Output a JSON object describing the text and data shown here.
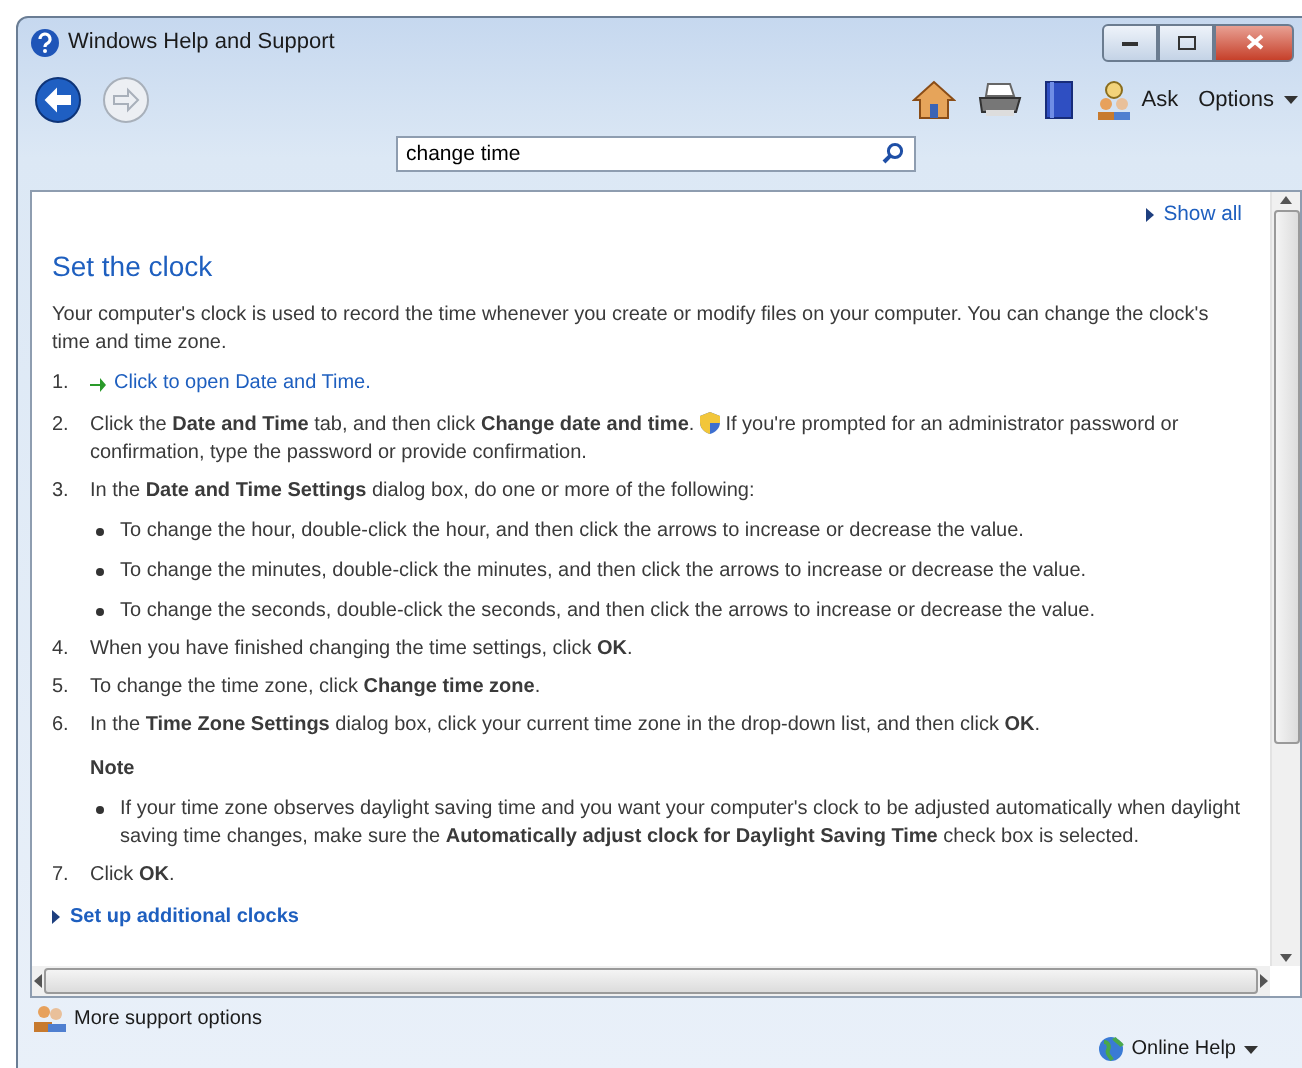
{
  "window": {
    "title": "Windows Help and Support"
  },
  "toolbar": {
    "back": {
      "disabled": false
    },
    "forward": {
      "disabled": true
    },
    "ask": "Ask",
    "options": "Options"
  },
  "search": {
    "value": "change time"
  },
  "content": {
    "show_all": "Show all",
    "heading": "Set the clock",
    "intro": "Your computer's clock is used to record the time whenever you create or modify files on your computer. You can change the clock's time and time zone.",
    "steps": [
      {
        "number": "1.",
        "kind": "link",
        "text": "Click to open Date and Time."
      },
      {
        "number": "2.",
        "kind": "text",
        "text": "Click the **Date and Time** tab, and then click **Change date and time**.",
        "text_after": "If you're prompted for an administrator password or confirmation, type the password or provide confirmation."
      },
      {
        "number": "3.",
        "kind": "text",
        "text": "In the **Date and Time Settings** dialog box, do one or more of the following:",
        "bullets": [
          "To change the hour, double-click the hour, and then click the arrows to increase or decrease the value.",
          "To change the minutes, double-click the minutes, and then click the arrows to increase or decrease the value.",
          "To change the seconds, double-click the seconds, and then click the arrows to increase or decrease the value."
        ]
      },
      {
        "number": "4.",
        "kind": "text",
        "text": "When you have finished changing the time settings, click **OK**."
      },
      {
        "number": "5.",
        "kind": "text",
        "text": "To change the time zone, click **Change time zone**."
      },
      {
        "number": "6.",
        "kind": "text",
        "text": "In the **Time Zone Settings** dialog box, click your current time zone in the drop-down list, and then click **OK**.",
        "note": {
          "title": "Note",
          "bullets": [
            "If your time zone observes daylight saving time and you want your computer's clock to be adjusted automatically when daylight saving time changes, make sure the **Automatically adjust clock for Daylight Saving Time** check box is selected."
          ]
        }
      },
      {
        "number": "7.",
        "kind": "text",
        "text": "Click **OK**."
      }
    ],
    "more_link": "Set up additional clocks"
  },
  "footer": {
    "more_support": "More support options",
    "online_help": "Online Help"
  }
}
